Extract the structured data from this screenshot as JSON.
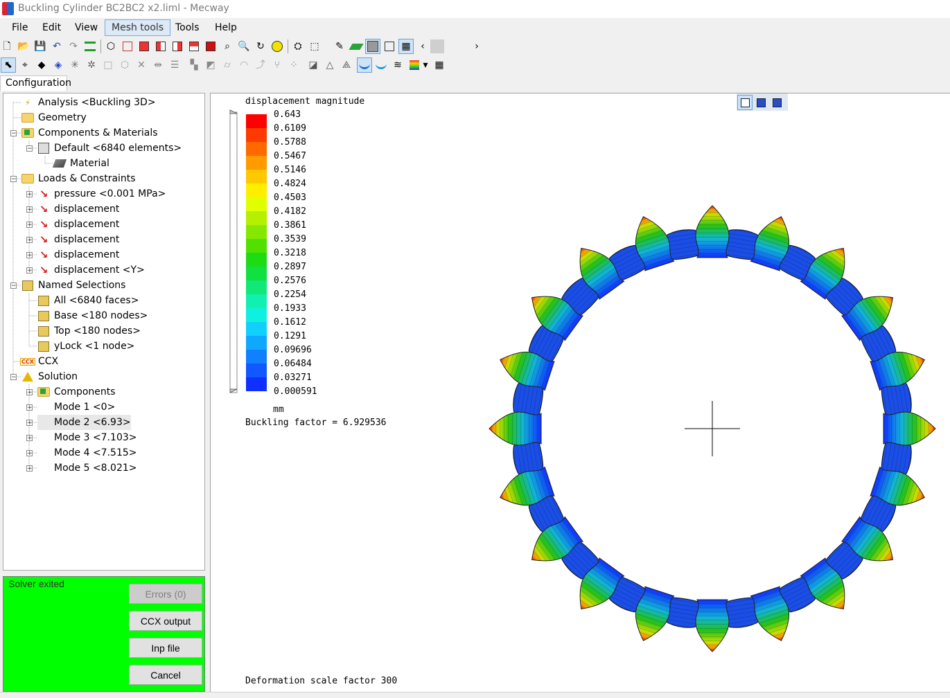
{
  "window": {
    "title": "Buckling Cylinder BC2BC2 x2.liml - Mecway"
  },
  "menu": [
    "File",
    "Edit",
    "View",
    "Mesh tools",
    "Tools",
    "Help"
  ],
  "menu_active": "Mesh tools",
  "tab": "Configuration",
  "tree": [
    {
      "label": "Analysis <Buckling 3D>",
      "icon": "analysis-icon"
    },
    {
      "label": "Geometry",
      "icon": "folder-icon"
    },
    {
      "label": "Components & Materials",
      "icon": "components-folder-icon"
    },
    {
      "label": "Default <6840 elements>",
      "icon": "component-icon"
    },
    {
      "label": "Material",
      "icon": "material-icon"
    },
    {
      "label": "Loads & Constraints",
      "icon": "loads-folder-icon"
    },
    {
      "label": "pressure <0.001 MPa>",
      "icon": "load-icon"
    },
    {
      "label": "displacement",
      "icon": "displacement-icon"
    },
    {
      "label": "displacement",
      "icon": "displacement-icon"
    },
    {
      "label": "displacement",
      "icon": "displacement-icon"
    },
    {
      "label": "displacement",
      "icon": "displacement-icon"
    },
    {
      "label": "displacement <Y>",
      "icon": "displacement-icon"
    },
    {
      "label": "Named Selections",
      "icon": "selections-folder-icon"
    },
    {
      "label": "All <6840 faces>",
      "icon": "selection-icon"
    },
    {
      "label": "Base <180 nodes>",
      "icon": "selection-icon"
    },
    {
      "label": "Top <180 nodes>",
      "icon": "selection-icon"
    },
    {
      "label": "yLock <1 node>",
      "icon": "selection-icon"
    },
    {
      "label": "CCX",
      "icon": "ccx-icon"
    },
    {
      "label": "Solution",
      "icon": "solution-icon"
    },
    {
      "label": "Components",
      "icon": "components-folder-icon"
    },
    {
      "label": "Mode 1 <0>",
      "icon": ""
    },
    {
      "label": "Mode 2 <6.93>",
      "icon": ""
    },
    {
      "label": "Mode 3 <7.103>",
      "icon": ""
    },
    {
      "label": "Mode 4 <7.515>",
      "icon": ""
    },
    {
      "label": "Mode 5 <8.021>",
      "icon": ""
    }
  ],
  "solver": {
    "status": "Solver exited",
    "errors_button": "Errors (0)",
    "ccx_button": "CCX output",
    "inp_button": "Inp file",
    "cancel_button": "Cancel",
    "status_color": "#00ff00"
  },
  "viewport": {
    "result_title": "displacement magnitude",
    "legend_values": [
      "0.643",
      "0.6109",
      "0.5788",
      "0.5467",
      "0.5146",
      "0.4824",
      "0.4503",
      "0.4182",
      "0.3861",
      "0.3539",
      "0.3218",
      "0.2897",
      "0.2576",
      "0.2254",
      "0.1933",
      "0.1612",
      "0.1291",
      "0.09696",
      "0.06484",
      "0.03271",
      "0.000591"
    ],
    "unit": "mm",
    "buckling_text": "Buckling factor = 6.929536",
    "scale_text": "Deformation scale factor 300",
    "lobe_count": 20
  }
}
